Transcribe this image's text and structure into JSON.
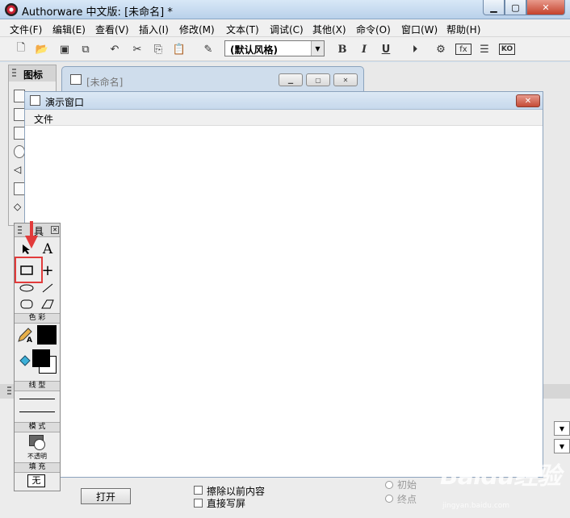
{
  "window": {
    "title": "Authorware 中文版: [未命名] *"
  },
  "menubar": [
    "文件(F)",
    "编辑(E)",
    "查看(V)",
    "插入(I)",
    "修改(M)",
    "文本(T)",
    "调试(C)",
    "其他(X)",
    "命令(O)",
    "窗口(W)",
    "帮助(H)"
  ],
  "toolbar": {
    "style_value": "(默认风格)",
    "bold": "B",
    "italic": "I",
    "underline": "U",
    "fx": "fx",
    "ko": "KO"
  },
  "icon_palette": {
    "title": "图标"
  },
  "flow_window": {
    "title": "[未命名]"
  },
  "presentation": {
    "title": "演示窗口",
    "menu_file": "文件"
  },
  "tools_palette": {
    "title": "具",
    "sections": {
      "color": "色 彩",
      "line": "线 型",
      "mode": "模 式",
      "fill": "填 充"
    },
    "mode_label": "不透明",
    "fill_value": "无"
  },
  "properties": {
    "open_button": "打开",
    "erase_checkbox": "擦除以前内容",
    "direct_checkbox": "直接写屏",
    "radio_start": "初始",
    "radio_end": "终点"
  },
  "watermark": {
    "brand": "Baidu经验",
    "url": "jingyan.baidu.com"
  },
  "colors": {
    "highlight": "#e23b3b",
    "title_bar": "#c6d8ec"
  }
}
